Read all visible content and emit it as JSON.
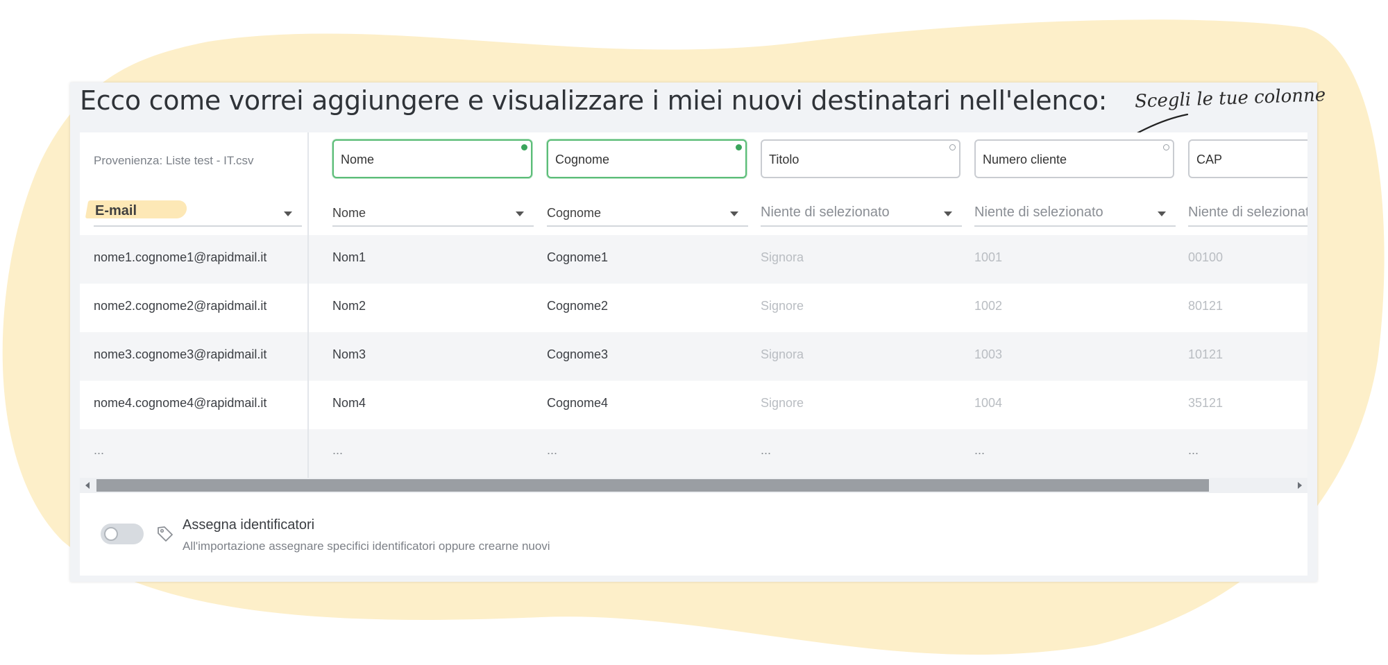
{
  "headline": "Ecco come vorrei aggiungere e visualizzare i miei nuovi destinatari nell'elenco:",
  "hint": "Scegli le tue colonne",
  "colors": {
    "blob": "#fdefc9",
    "accent_green": "#3ba55c",
    "email_highlight": "#fde8b6",
    "row_alt": "#f4f5f7"
  },
  "source": {
    "label": "Provenienza: Liste test - IT.csv",
    "email_field": "E-mail",
    "emails": [
      "nome1.cognome1@rapidmail.it",
      "nome2.cognome2@rapidmail.it",
      "nome3.cognome3@rapidmail.it",
      "nome4.cognome4@rapidmail.it"
    ],
    "ellipsis": "..."
  },
  "columns": [
    {
      "name": "Nome",
      "active": true,
      "mapped": "Nome",
      "mapped_selected": true,
      "cells": [
        "Nom1",
        "Nom2",
        "Nom3",
        "Nom4"
      ],
      "ellipsis": "..."
    },
    {
      "name": "Cognome",
      "active": true,
      "mapped": "Cognome",
      "mapped_selected": true,
      "cells": [
        "Cognome1",
        "Cognome2",
        "Cognome3",
        "Cognome4"
      ],
      "ellipsis": "..."
    },
    {
      "name": "Titolo",
      "active": false,
      "mapped": "Niente di selezionato",
      "mapped_selected": false,
      "cells": [
        "Signora",
        "Signore",
        "Signora",
        "Signore"
      ],
      "ellipsis": "..."
    },
    {
      "name": "Numero cliente",
      "active": false,
      "mapped": "Niente di selezionato",
      "mapped_selected": false,
      "cells": [
        "1001",
        "1002",
        "1003",
        "1004"
      ],
      "ellipsis": "..."
    },
    {
      "name": "CAP",
      "active": false,
      "mapped": "Niente di selezionato",
      "mapped_selected": false,
      "cells": [
        "00100",
        "80121",
        "10121",
        "35121"
      ],
      "ellipsis": "..."
    }
  ],
  "scroll": {
    "position": 0,
    "visible_fraction": 0.93
  },
  "identifiers": {
    "title": "Assegna identificatori",
    "description": "All'importazione assegnare specifici identificatori oppure crearne nuovi",
    "enabled": false
  }
}
